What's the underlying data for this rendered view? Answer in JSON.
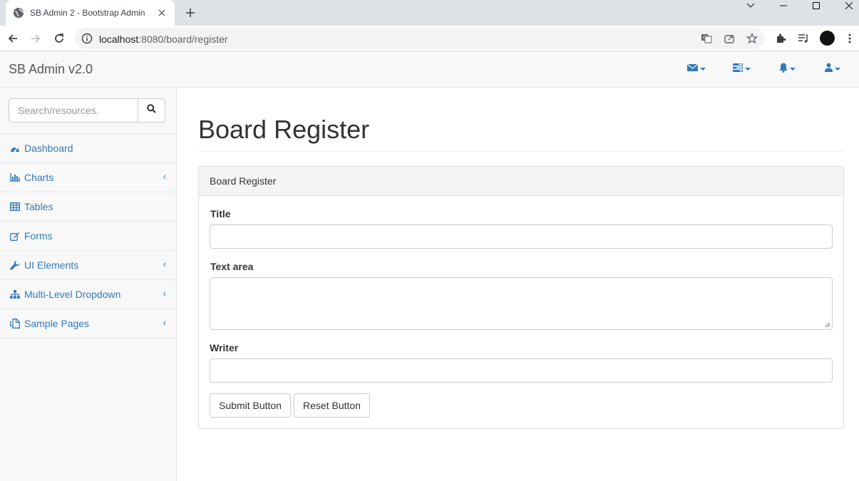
{
  "browser": {
    "tab_title": "SB Admin 2 - Bootstrap Admin",
    "url_host": "localhost",
    "url_rest": ":8080/board/register"
  },
  "header": {
    "brand": "SB Admin v2.0",
    "dropdowns": [
      "envelope-icon",
      "tasks-icon",
      "bell-icon",
      "user-icon"
    ],
    "accent_color": "#337ab7"
  },
  "sidebar": {
    "search_placeholder": "Search/resources.",
    "items": [
      {
        "label": "Dashboard",
        "icon": "dashboard-icon",
        "has_arrow": false
      },
      {
        "label": "Charts",
        "icon": "bar-chart-icon",
        "has_arrow": true
      },
      {
        "label": "Tables",
        "icon": "table-icon",
        "has_arrow": false
      },
      {
        "label": "Forms",
        "icon": "edit-icon",
        "has_arrow": false
      },
      {
        "label": "UI Elements",
        "icon": "wrench-icon",
        "has_arrow": true
      },
      {
        "label": "Multi-Level Dropdown",
        "icon": "sitemap-icon",
        "has_arrow": true
      },
      {
        "label": "Sample Pages",
        "icon": "files-icon",
        "has_arrow": true
      }
    ],
    "arrow": "‹"
  },
  "main": {
    "page_title": "Board Register",
    "panel_heading": "Board Register",
    "fields": {
      "title_label": "Title",
      "title_value": "",
      "textarea_label": "Text area",
      "textarea_value": "",
      "writer_label": "Writer",
      "writer_value": ""
    },
    "buttons": {
      "submit": "Submit Button",
      "reset": "Reset Button"
    }
  }
}
